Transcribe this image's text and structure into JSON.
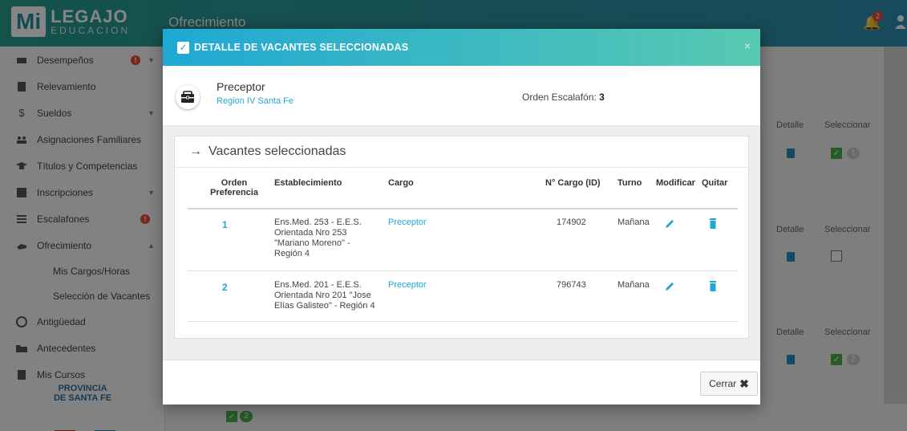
{
  "app": {
    "logo_mi": "Mi",
    "logo_title": "LEGAJO",
    "logo_subtitle": "EDUCACION",
    "page_title": "Ofrecimiento",
    "notification_count": "2"
  },
  "sidebar": {
    "items": [
      {
        "label": "Desempeños"
      },
      {
        "label": "Relevamiento"
      },
      {
        "label": "Sueldos"
      },
      {
        "label": "Asignaciones Familiares"
      },
      {
        "label": "Títulos y Competencias"
      },
      {
        "label": "Inscripciones"
      },
      {
        "label": "Escalafones"
      },
      {
        "label": "Ofrecimiento"
      }
    ],
    "sub_items": [
      {
        "label": "Mis Cargos/Horas"
      },
      {
        "label": "Selección de Vacantes"
      }
    ],
    "items_after": [
      {
        "label": "Antigüedad"
      },
      {
        "label": "Antecedentes"
      },
      {
        "label": "Mis Cursos"
      }
    ],
    "footer_line1": "PROVINCIA",
    "footer_line2": "DE SANTA FE",
    "desempenos_badge": "!",
    "escalafones_badge": "!"
  },
  "background_table": {
    "col_detalle": "Detalle",
    "col_seleccionar": "Seleccionar",
    "counts": [
      "1",
      "2"
    ],
    "bottom_count": "2"
  },
  "modal": {
    "title": "DETALLE DE VACANTES SELECCIONADAS",
    "close": "×",
    "cargo": "Preceptor",
    "region": "Region IV Santa Fe",
    "orden_label": "Orden Escalafón:",
    "orden_value": "3",
    "panel_title": "Vacantes seleccionadas",
    "columns": {
      "orden_l1": "Orden",
      "orden_l2": "Preferencia",
      "establecimiento": "Establecimiento",
      "cargo": "Cargo",
      "n_cargo": "N° Cargo (ID)",
      "turno": "Turno",
      "modificar": "Modificar",
      "quitar": "Quitar"
    },
    "rows": [
      {
        "orden": "1",
        "est_l1": "Ens.Med. 253 - E.E.S.",
        "est_l2": "Orientada Nro 253",
        "est_l3": "\"Mariano Moreno\" -",
        "est_l4": "Región 4",
        "cargo": "Preceptor",
        "id": "174902",
        "turno": "Mañana"
      },
      {
        "orden": "2",
        "est_l1": "Ens.Med. 201 - E.E.S.",
        "est_l2": "Orientada Nro 201 \"Jose",
        "est_l3": "Elías Galisteo\" - Región 4",
        "cargo": "Preceptor",
        "id": "796743",
        "turno": "Mañana"
      }
    ],
    "close_button": "Cerrar"
  },
  "colors": {
    "accent": "#1fa8d4",
    "header_gradient_end": "#58c9b0",
    "badge": "#e74c3c"
  }
}
